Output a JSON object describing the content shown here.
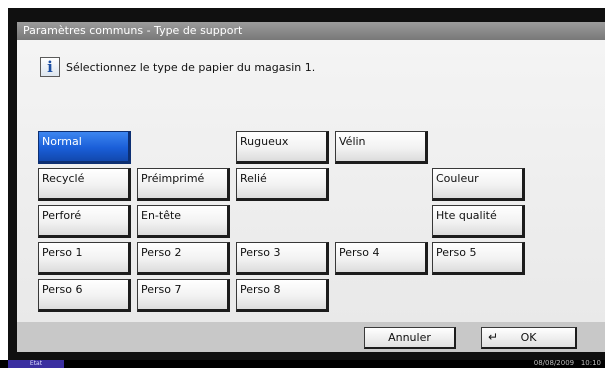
{
  "title": "Paramètres communs - Type de support",
  "instruction": "Sélectionnez le type de papier du magasin 1.",
  "icons": {
    "info": "info-icon",
    "ok": "enter-arrow-icon"
  },
  "buttons": {
    "normal": "Normal",
    "rugueux": "Rugueux",
    "velin": "Vélin",
    "recycle": "Recyclé",
    "preimprime": "Préimprimé",
    "relie": "Relié",
    "couleur": "Couleur",
    "perfore": "Perforé",
    "entete": "En-tête",
    "hte_qualite": "Hte qualité",
    "perso1": "Perso 1",
    "perso2": "Perso 2",
    "perso3": "Perso 3",
    "perso4": "Perso 4",
    "perso5": "Perso 5",
    "perso6": "Perso 6",
    "perso7": "Perso 7",
    "perso8": "Perso 8"
  },
  "selected": "Normal",
  "actions": {
    "cancel": "Annuler",
    "ok": "OK"
  },
  "status": {
    "label": "État",
    "date": "08/08/2009",
    "time": "10:10"
  },
  "colors": {
    "selected": "#1a5ed8",
    "title_bar": "#8a8a8a",
    "status_tab": "#3b2fa0"
  }
}
